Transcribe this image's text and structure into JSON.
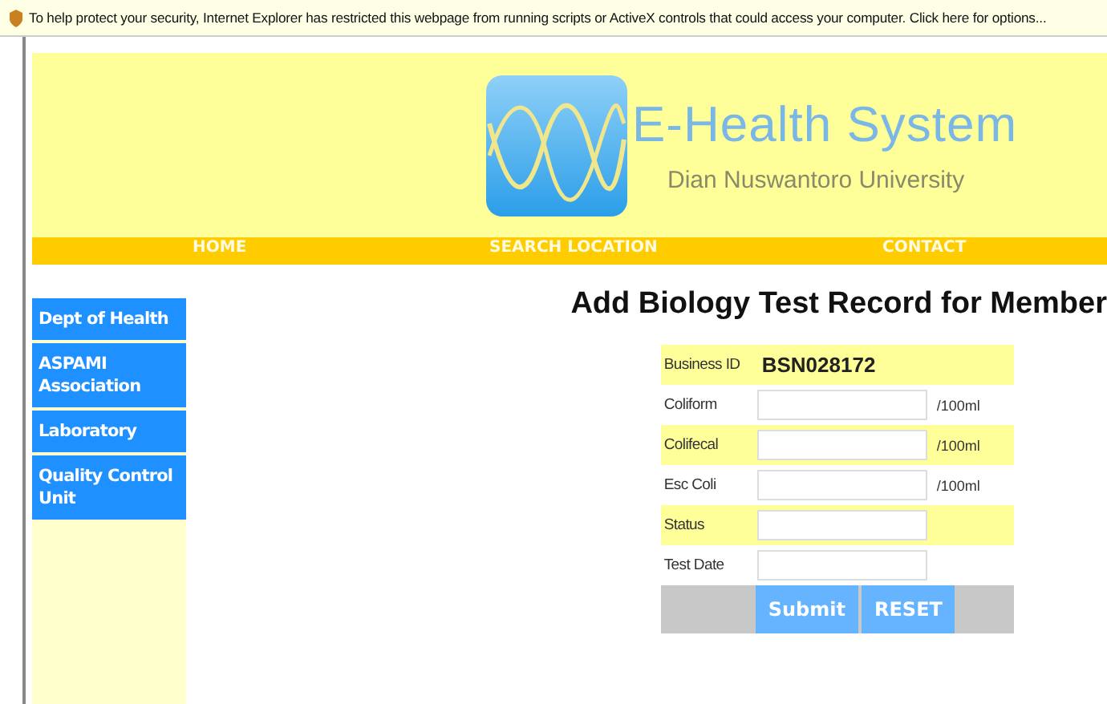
{
  "info_bar": {
    "text": "To help protect your security, Internet Explorer has restricted this webpage from running scripts or ActiveX controls that could access your computer. Click here for options..."
  },
  "header": {
    "title": "E-Health System",
    "subtitle": "Dian Nuswantoro University"
  },
  "nav": [
    "HOME",
    "SEARCH LOCATION",
    "CONTACT"
  ],
  "sidebar": {
    "items": [
      "Dept of Health",
      "ASPAMI Association",
      "Laboratory",
      "Quality Control Unit"
    ]
  },
  "form": {
    "title": "Add Biology Test Record for Member",
    "rows": [
      {
        "kind": "value",
        "label": "Business ID",
        "value": "BSN028172"
      },
      {
        "kind": "input",
        "label": "Coliform",
        "unit": "/100ml"
      },
      {
        "kind": "input",
        "label": "Colifecal",
        "unit": "/100ml"
      },
      {
        "kind": "input",
        "label": "Esc Coli",
        "unit": "/100ml"
      },
      {
        "kind": "input",
        "label": "Status"
      },
      {
        "kind": "input",
        "label": "Test Date"
      }
    ],
    "buttons": [
      "Submit",
      "RESET"
    ]
  }
}
